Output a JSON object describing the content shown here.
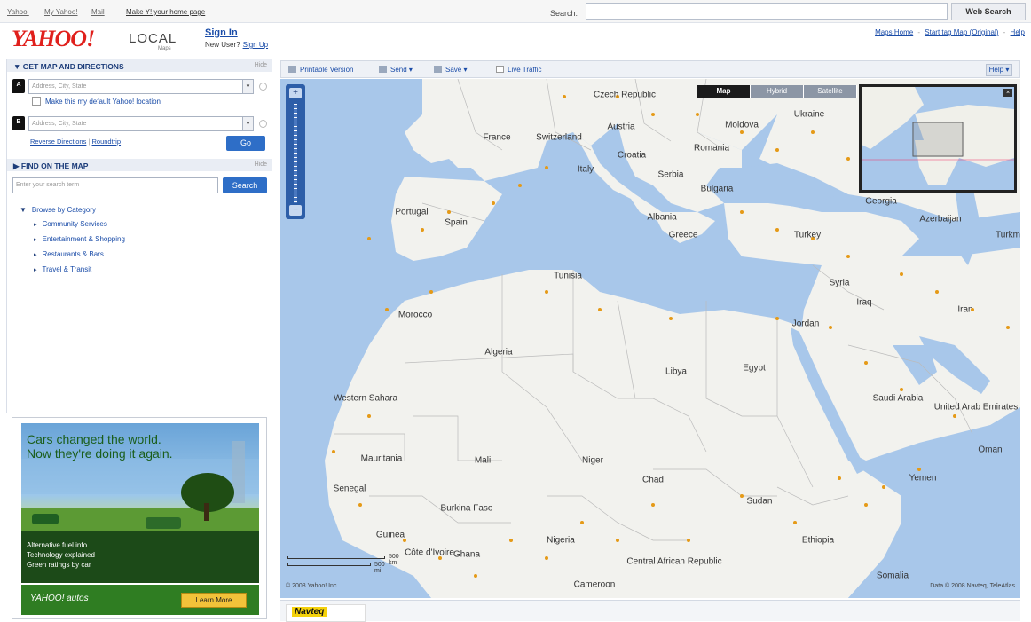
{
  "topbar": {
    "links": [
      "Yahoo!",
      "My Yahoo!",
      "Mail",
      "Make Y! your home page"
    ],
    "search_label": "Search:",
    "search_placeholder": "",
    "search_button": "Web Search"
  },
  "brand": {
    "logo": "YAHOO!",
    "product": "LOCAL",
    "sub": "Maps"
  },
  "account": {
    "signin": "Sign In",
    "new_user": "New User?",
    "signup": "Sign Up"
  },
  "header_links": [
    "Maps Home",
    "Start tag Map (Original)",
    "Help"
  ],
  "directions": {
    "title": "GET MAP AND DIRECTIONS",
    "hide": "Hide",
    "start_pin": "A",
    "end_pin": "B",
    "start_placeholder": "Address, City, State",
    "end_placeholder": "Address, City, State",
    "default_location_label": "Make this my default Yahoo! location",
    "reverse": "Reverse Directions",
    "roundtrip": "Roundtrip",
    "go": "Go"
  },
  "find": {
    "title": "FIND ON THE MAP",
    "hide": "Hide",
    "placeholder": "Enter your search term",
    "search_button": "Search",
    "browse_heading": "Browse by Category",
    "categories": [
      "Community Services",
      "Entertainment & Shopping",
      "Restaurants & Bars",
      "Travel & Transit"
    ]
  },
  "ad": {
    "headline_1": "Cars changed the world.",
    "headline_2": "Now they're doing it again.",
    "features": [
      "Alternative fuel info",
      "Technology explained",
      "Green ratings by car"
    ],
    "brand": "YAHOO! autos",
    "cta": "Learn More"
  },
  "map_toolbar": {
    "printable": "Printable Version",
    "send": "Send ▾",
    "save": "Save ▾",
    "traffic": "Live Traffic",
    "help": "Help ▾"
  },
  "map_types": [
    "Map",
    "Hybrid",
    "Satellite"
  ],
  "map_labels": {
    "france": "France",
    "switzerland": "Switzerland",
    "austria": "Austria",
    "czech": "Czech Republic",
    "ukraine": "Ukraine",
    "moldova": "Moldova",
    "romania": "Romania",
    "croatia": "Croatia",
    "italy": "Italy",
    "serbia": "Serbia",
    "bulgaria": "Bulgaria",
    "portugal": "Portugal",
    "spain": "Spain",
    "albania": "Albania",
    "greece": "Greece",
    "turkey": "Turkey",
    "georgia": "Georgia",
    "azerbaijan": "Azerbaijan",
    "turkmenistan": "Turkm",
    "tunisia": "Tunisia",
    "syria": "Syria",
    "iraq": "Iraq",
    "morocco": "Morocco",
    "algeria": "Algeria",
    "libya": "Libya",
    "egypt": "Egypt",
    "jordan": "Jordan",
    "western_sahara": "Western Sahara",
    "saudi": "Saudi Arabia",
    "uae": "United Arab Emirates",
    "oman": "Oman",
    "mauritania": "Mauritania",
    "mali": "Mali",
    "niger": "Niger",
    "chad": "Chad",
    "sudan": "Sudan",
    "yemen": "Yemen",
    "senegal": "Senegal",
    "burkina": "Burkina Faso",
    "guinea": "Guinea",
    "cote": "Côte d'Ivoire",
    "ghana": "Ghana",
    "nigeria": "Nigeria",
    "ethiopia": "Ethiopia",
    "car": "Central African Republic",
    "cameroon": "Cameroon",
    "somalia": "Somalia",
    "iran": "Iran"
  },
  "scale": {
    "km": "500 km",
    "mi": "500 mi"
  },
  "copyright_left": "© 2008 Yahoo! Inc.",
  "copyright_right": "Data © 2008 Navteq, TeleAtlas",
  "sponsor": "Navteq"
}
